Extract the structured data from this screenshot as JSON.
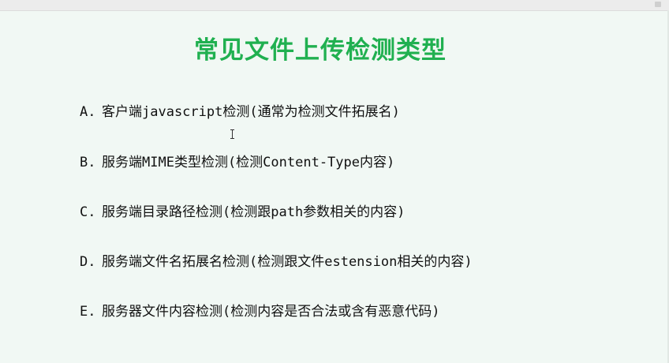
{
  "slide": {
    "title": "常见文件上传检测类型",
    "title_color": "#20b050",
    "background_color": "#f1f8f4",
    "items": [
      {
        "marker": "A.",
        "text": "客户端javascript检测(通常为检测文件拓展名)"
      },
      {
        "marker": "B.",
        "text": "服务端MIME类型检测(检测Content-Type内容)"
      },
      {
        "marker": "C.",
        "text": "服务端目录路径检测(检测跟path参数相关的内容)"
      },
      {
        "marker": "D.",
        "text": "服务端文件名拓展名检测(检测跟文件estension相关的内容)"
      },
      {
        "marker": "E.",
        "text": "服务器文件内容检测(检测内容是否合法或含有恶意代码)"
      }
    ]
  },
  "cursor": {
    "icon": "text-ibeam-cursor-icon"
  }
}
